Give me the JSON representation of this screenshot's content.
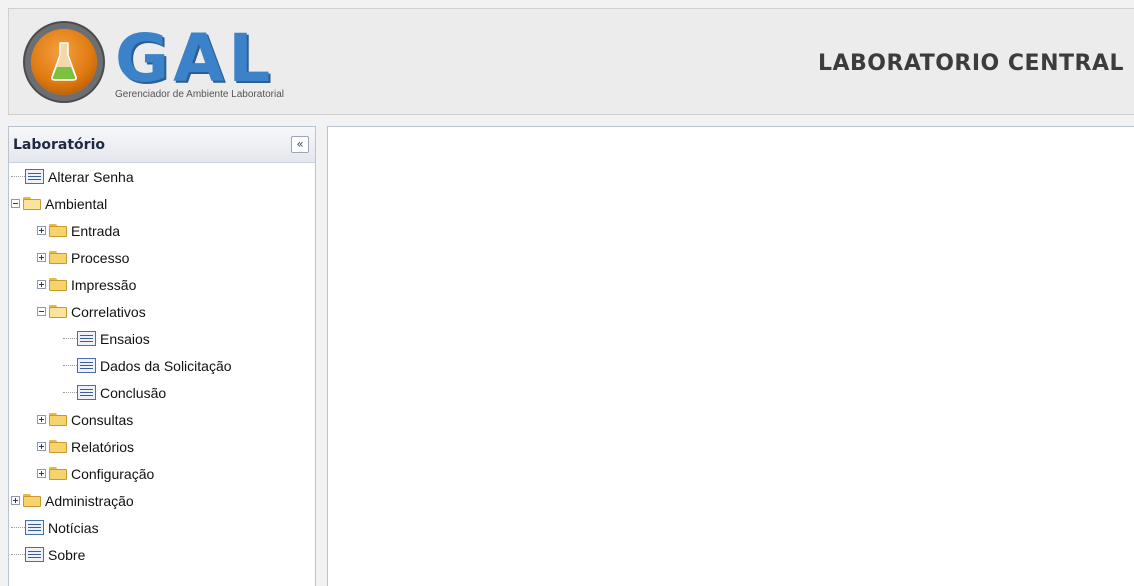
{
  "header": {
    "logo_text": "GAL",
    "logo_subtitle": "Gerenciador de Ambiente Laboratorial",
    "org_title": "LABORATORIO CENTRAL"
  },
  "sidebar": {
    "title": "Laboratório",
    "collapse_glyph": "«",
    "tree": [
      {
        "label": "Alterar Senha",
        "type": "leaf",
        "level": 0
      },
      {
        "label": "Ambiental",
        "type": "folder",
        "expanded": true,
        "level": 0
      },
      {
        "label": "Entrada",
        "type": "folder",
        "expanded": false,
        "level": 1
      },
      {
        "label": "Processo",
        "type": "folder",
        "expanded": false,
        "level": 1
      },
      {
        "label": "Impressão",
        "type": "folder",
        "expanded": false,
        "level": 1
      },
      {
        "label": "Correlativos",
        "type": "folder",
        "expanded": true,
        "level": 1
      },
      {
        "label": "Ensaios",
        "type": "leaf",
        "level": 2
      },
      {
        "label": "Dados da Solicitação",
        "type": "leaf",
        "level": 2
      },
      {
        "label": "Conclusão",
        "type": "leaf",
        "level": 2
      },
      {
        "label": "Consultas",
        "type": "folder",
        "expanded": false,
        "level": 1
      },
      {
        "label": "Relatórios",
        "type": "folder",
        "expanded": false,
        "level": 1
      },
      {
        "label": "Configuração",
        "type": "folder",
        "expanded": false,
        "level": 1
      },
      {
        "label": "Administração",
        "type": "folder",
        "expanded": false,
        "level": 0
      },
      {
        "label": "Notícias",
        "type": "leaf",
        "level": 0
      },
      {
        "label": "Sobre",
        "type": "leaf",
        "level": 0
      }
    ]
  }
}
